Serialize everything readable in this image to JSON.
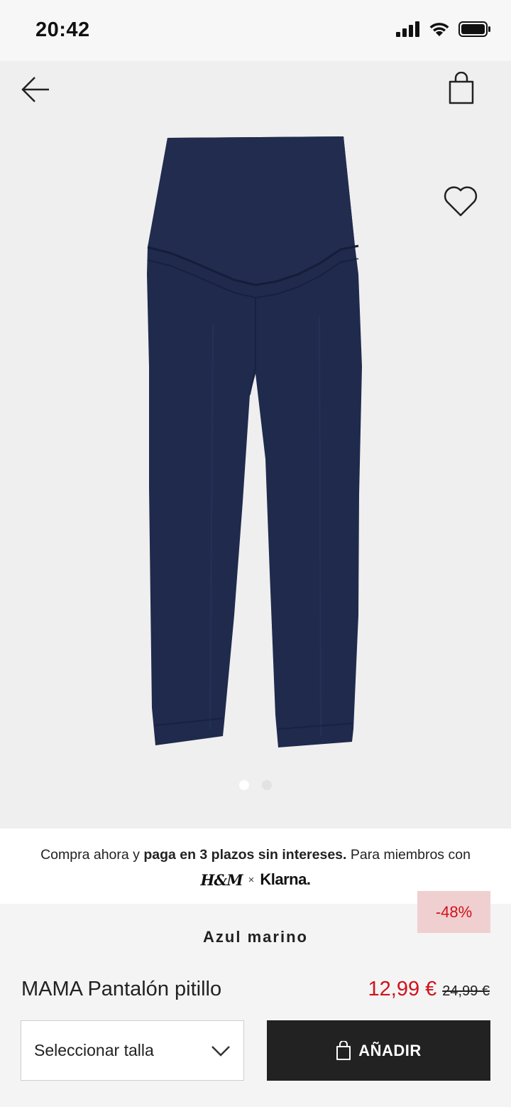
{
  "status_bar": {
    "time": "20:42",
    "icons": [
      "signal-icon",
      "wifi-icon",
      "battery-icon"
    ]
  },
  "header": {
    "back_icon": "arrow-left-icon",
    "bag_icon": "shopping-bag-icon"
  },
  "gallery": {
    "favorite_icon": "heart-icon",
    "image_count": 2,
    "active_index": 0
  },
  "klarna_banner": {
    "text_before": "Compra ahora y ",
    "text_bold": "paga en 3 plazos sin intereses.",
    "text_after": " Para miembros con",
    "hm_logo": "H&M",
    "separator": "×",
    "klarna_logo": "Klarna."
  },
  "product": {
    "discount": "-48%",
    "color": "Azul marino",
    "name": "MAMA Pantalón pitillo",
    "price": "12,99 €",
    "old_price": "24,99 €"
  },
  "actions": {
    "size_label": "Seleccionar talla",
    "add_label": "AÑADIR"
  },
  "colors": {
    "sale_red": "#d0121b",
    "discount_bg": "#f0cfd0",
    "button_dark": "#222222",
    "product_navy": "#1f2a4d"
  }
}
